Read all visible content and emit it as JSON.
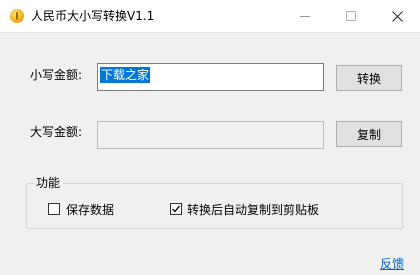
{
  "window": {
    "title": "人民币大小写转换V1.1",
    "icon": "coin-icon"
  },
  "form": {
    "small_label": "小写金额:",
    "small_value": "下载之家",
    "big_label": "大写金额:",
    "big_value": "",
    "convert_button": "转换",
    "copy_button": "复制"
  },
  "options": {
    "group_title": "功能",
    "save_data": {
      "label": "保存数据",
      "checked": false
    },
    "auto_copy": {
      "label": "转换后自动复制到剪贴板",
      "checked": true
    }
  },
  "footer": {
    "feedback_link": "反馈"
  },
  "colors": {
    "selection": "#0078d7",
    "link": "#0066cc",
    "background": "#f0f0f0"
  }
}
